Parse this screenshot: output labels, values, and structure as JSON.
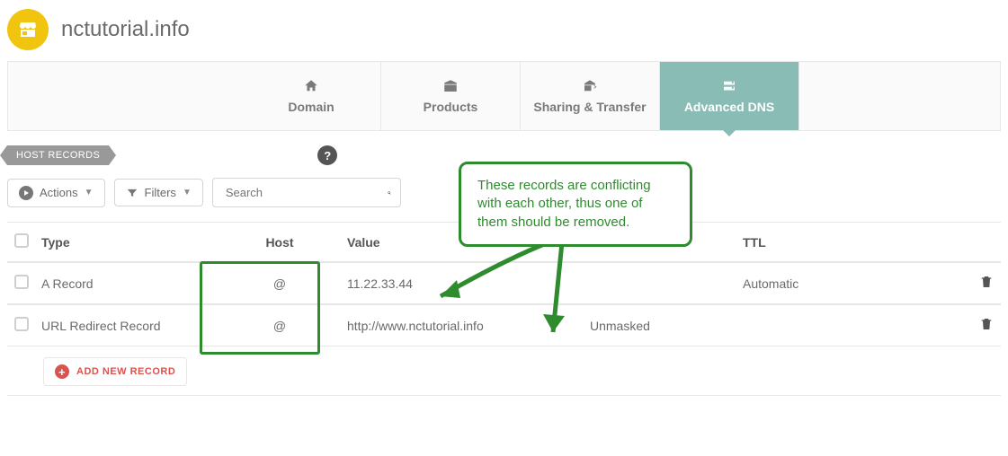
{
  "header": {
    "domain": "nctutorial.info"
  },
  "tabs": {
    "domain": "Domain",
    "products": "Products",
    "sharing": "Sharing & Transfer",
    "advanced": "Advanced DNS"
  },
  "section": {
    "label": "HOST RECORDS"
  },
  "toolbar": {
    "actions_label": "Actions",
    "filters_label": "Filters",
    "search_placeholder": "Search"
  },
  "columns": {
    "type": "Type",
    "host": "Host",
    "value": "Value",
    "ttl": "TTL"
  },
  "records": [
    {
      "type": "A Record",
      "host": "@",
      "value": "11.22.33.44",
      "mask": "",
      "ttl": "Automatic"
    },
    {
      "type": "URL Redirect Record",
      "host": "@",
      "value": "http://www.nctutorial.info",
      "mask": "Unmasked",
      "ttl": ""
    }
  ],
  "add_label": "ADD NEW RECORD",
  "callout": {
    "text": "These records are conflicting with each other, thus one of them should be removed."
  },
  "colors": {
    "accent": "#88bcb4",
    "brand": "#f1c40f",
    "danger": "#d9534f",
    "highlight": "#2e8b2e"
  }
}
